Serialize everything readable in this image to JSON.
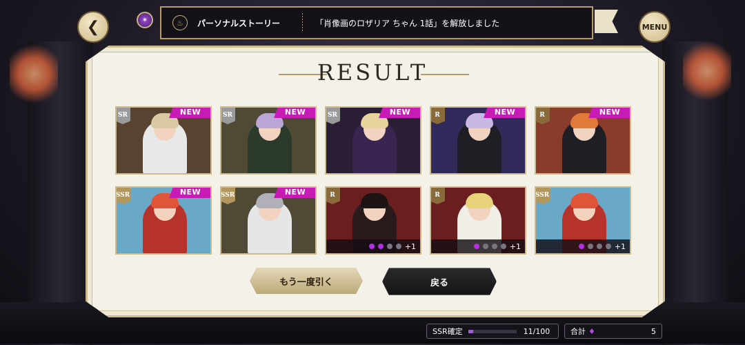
{
  "header": {
    "notice_gem_icon": "star-gem-icon",
    "notice_title": "パーソナルストーリー",
    "notice_message": "「肖像画のロザリア ちゃん 1話」を解放しました",
    "menu_label": "MENU"
  },
  "result": {
    "title": "RESULT",
    "cards": [
      {
        "rarity": "SR",
        "new": "NEW",
        "colors": {
          "bg": "#5a4230",
          "figure": "#e8e8e8",
          "hair": "#d9c9a3"
        }
      },
      {
        "rarity": "SR",
        "new": "NEW",
        "colors": {
          "bg": "#4e4a36",
          "figure": "#2c3a2c",
          "hair": "#b9a6d6"
        }
      },
      {
        "rarity": "SR",
        "new": "NEW",
        "colors": {
          "bg": "#2a1e36",
          "figure": "#3a2550",
          "hair": "#e6d39e"
        }
      },
      {
        "rarity": "R",
        "new": "NEW",
        "colors": {
          "bg": "#2f2a5a",
          "figure": "#1e1e24",
          "hair": "#c7b8e6"
        }
      },
      {
        "rarity": "R",
        "new": "NEW",
        "colors": {
          "bg": "#8a3c2c",
          "figure": "#1e1e24",
          "hair": "#e07a3a"
        }
      },
      {
        "rarity": "SSR",
        "new": "NEW",
        "colors": {
          "bg": "#6aa8c8",
          "figure": "#b8322c",
          "hair": "#e0553a"
        }
      },
      {
        "rarity": "SSR",
        "new": "NEW",
        "colors": {
          "bg": "#4e4a36",
          "figure": "#e6e6e6",
          "hair": "#b0b0b8"
        }
      },
      {
        "rarity": "R",
        "new": "",
        "colors": {
          "bg": "#6a1e20",
          "figure": "#2a1a1c",
          "hair": "#1e1414"
        },
        "dupe": {
          "filled": 2,
          "total": 4,
          "extra": "+1"
        }
      },
      {
        "rarity": "R",
        "new": "",
        "colors": {
          "bg": "#6a1e20",
          "figure": "#f0eee6",
          "hair": "#e8d27a"
        },
        "dupe": {
          "filled": 1,
          "total": 4,
          "extra": "+1"
        }
      },
      {
        "rarity": "SSR",
        "new": "",
        "colors": {
          "bg": "#6aa8c8",
          "figure": "#b8322c",
          "hair": "#e0553a"
        },
        "dupe": {
          "filled": 1,
          "total": 4,
          "extra": "+1"
        }
      }
    ],
    "rarity_colors": {
      "SR": "#9a9a9a",
      "R": "#8a6a3a",
      "SSR": "#b4955c"
    }
  },
  "buttons": {
    "again_label": "もう一度引く",
    "back_label": "戻る"
  },
  "footer": {
    "ssr_label": "SSR確定",
    "ssr_progress": 0.11,
    "ssr_count": "11/100",
    "total_label": "合計",
    "total_value": "5"
  }
}
